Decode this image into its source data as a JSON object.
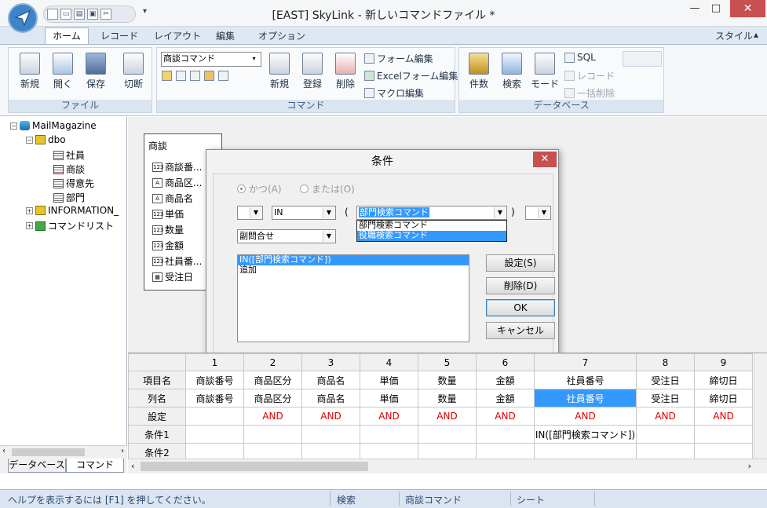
{
  "window": {
    "title": "[EAST] SkyLink - 新しいコマンドファイル *"
  },
  "ribbon_tabs": [
    "ホーム",
    "レコード",
    "レイアウト",
    "編集",
    "オプション"
  ],
  "style_label": "スタイル",
  "ribbon": {
    "file_group": {
      "label": "ファイル",
      "new": "新規",
      "open": "開く",
      "save": "保存",
      "switch": "切断"
    },
    "command_group": {
      "label": "コマンド",
      "command_combo": "商談コマンド",
      "new": "新規",
      "register": "登録",
      "delete": "削除",
      "form_edit": "フォーム編集",
      "excel_form_edit": "Excelフォーム編集",
      "macro_edit": "マクロ編集"
    },
    "database_group": {
      "label": "データベース",
      "count": "件数",
      "search": "検索",
      "mode": "モード",
      "sql": "SQL",
      "record": "レコード",
      "bulk_delete": "一括削除"
    }
  },
  "tree": {
    "root": "MailMagazine",
    "schema": "dbo",
    "tables": [
      "社員",
      "商談",
      "得意先",
      "部門"
    ],
    "info_schema": "INFORMATION_",
    "command_list": "コマンドリスト",
    "bottom_tabs": [
      "データベース",
      "コマンド"
    ]
  },
  "table_box": {
    "name": "商談",
    "fields": [
      {
        "icon": "123",
        "label": "商談番..."
      },
      {
        "icon": "A",
        "label": "商品区..."
      },
      {
        "icon": "A",
        "label": "商品名"
      },
      {
        "icon": "123",
        "label": "単価"
      },
      {
        "icon": "123",
        "label": "数量"
      },
      {
        "icon": "123",
        "label": "金額"
      },
      {
        "icon": "123",
        "label": "社員番..."
      },
      {
        "icon": "date",
        "label": "受注日"
      }
    ]
  },
  "dialog": {
    "title": "条件",
    "radio_and": "かつ(A)",
    "radio_or": "または(O)",
    "operator": "IN",
    "open_paren": "(",
    "close_paren": ")",
    "command_combo_value": "部門検索コマンド",
    "dropdown_options": [
      "部門検索コマンド",
      "役職検索コマンド"
    ],
    "subquery": "副問合せ",
    "conditions": [
      "IN([部門検索コマンド])",
      "追加"
    ],
    "buttons": {
      "set": "設定(S)",
      "delete": "削除(D)",
      "ok": "OK",
      "cancel": "キャンセル"
    }
  },
  "grid": {
    "columns": [
      "1",
      "2",
      "3",
      "4",
      "5",
      "6",
      "7",
      "8",
      "9"
    ],
    "row_headers": [
      "項目名",
      "列名",
      "設定",
      "条件1",
      "条件2"
    ],
    "item_names": [
      "商談番号",
      "商品区分",
      "商品名",
      "単価",
      "数量",
      "金額",
      "社員番号",
      "受注日",
      "締切日"
    ],
    "column_names": [
      "商談番号",
      "商品区分",
      "商品名",
      "単価",
      "数量",
      "金額",
      "社員番号",
      "受注日",
      "締切日"
    ],
    "settings": [
      "",
      "AND",
      "AND",
      "AND",
      "AND",
      "AND",
      "AND",
      "AND",
      "AND"
    ],
    "condition1": [
      "",
      "",
      "",
      "",
      "",
      "",
      "IN([部門検索コマンド])",
      "",
      ""
    ],
    "condition2": [
      "",
      "",
      "",
      "",
      "",
      "",
      "",
      "",
      ""
    ]
  },
  "status": {
    "help": "ヘルプを表示するには [F1] を押してください。",
    "mode": "検索",
    "command": "商談コマンド",
    "view": "シート"
  }
}
